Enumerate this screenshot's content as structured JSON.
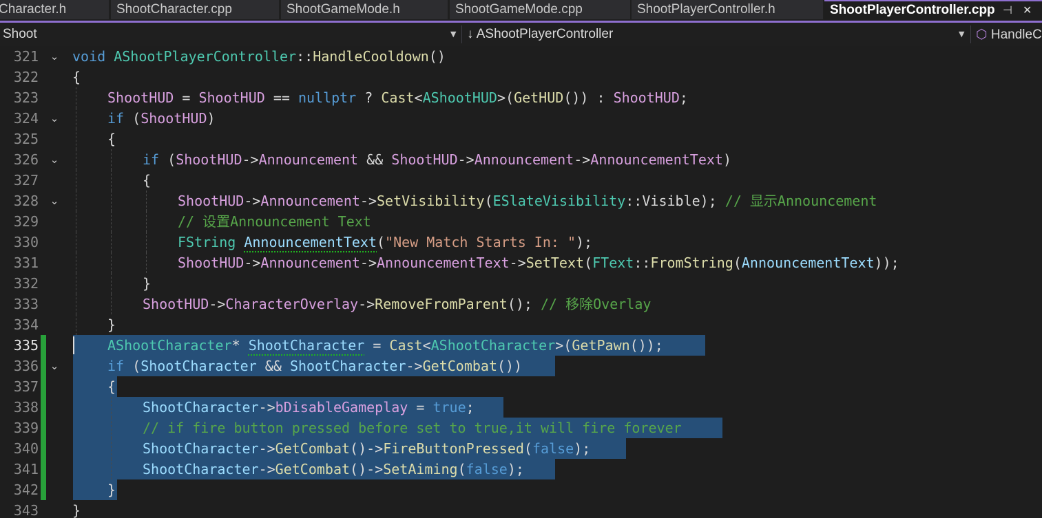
{
  "tabs": [
    {
      "label": "Character.h",
      "active": false
    },
    {
      "label": "ShootCharacter.cpp",
      "active": false
    },
    {
      "label": "ShootGameMode.h",
      "active": false
    },
    {
      "label": "ShootGameMode.cpp",
      "active": false
    },
    {
      "label": "ShootPlayerController.h",
      "active": false
    },
    {
      "label": "ShootPlayerController.cpp",
      "active": true
    }
  ],
  "tab_icons": {
    "pin": "⊣",
    "close": "✕"
  },
  "navbar": {
    "project": "Shoot",
    "scope_prefix": "↓",
    "scope": "AShootPlayerController",
    "member": "HandleC"
  },
  "editor": {
    "lines": [
      {
        "n": "321",
        "fold": true
      },
      {
        "n": "322",
        "fold": false
      },
      {
        "n": "323",
        "fold": false
      },
      {
        "n": "324",
        "fold": true
      },
      {
        "n": "325",
        "fold": false
      },
      {
        "n": "326",
        "fold": true
      },
      {
        "n": "327",
        "fold": false
      },
      {
        "n": "328",
        "fold": true
      },
      {
        "n": "329",
        "fold": false
      },
      {
        "n": "330",
        "fold": false
      },
      {
        "n": "331",
        "fold": false
      },
      {
        "n": "332",
        "fold": false
      },
      {
        "n": "333",
        "fold": false
      },
      {
        "n": "334",
        "fold": false
      },
      {
        "n": "335",
        "fold": false
      },
      {
        "n": "336",
        "fold": true
      },
      {
        "n": "337",
        "fold": false
      },
      {
        "n": "338",
        "fold": false
      },
      {
        "n": "339",
        "fold": false
      },
      {
        "n": "340",
        "fold": false
      },
      {
        "n": "341",
        "fold": false
      },
      {
        "n": "342",
        "fold": false
      },
      {
        "n": "343",
        "fold": false
      }
    ],
    "code": {
      "l321": [
        "void",
        "AShootPlayerController",
        "::",
        "HandleCooldown",
        "()"
      ],
      "l322": [
        "{"
      ],
      "l323": [
        "ShootHUD",
        " = ",
        "ShootHUD",
        " == ",
        "nullptr",
        " ? ",
        "Cast",
        "<",
        "AShootHUD",
        ">(",
        "GetHUD",
        "()) : ",
        "ShootHUD",
        ";"
      ],
      "l324": [
        "if",
        " (",
        "ShootHUD",
        ")"
      ],
      "l325": [
        "{"
      ],
      "l326": [
        "if",
        " (",
        "ShootHUD",
        "->",
        "Announcement",
        " && ",
        "ShootHUD",
        "->",
        "Announcement",
        "->",
        "AnnouncementText",
        ")"
      ],
      "l327": [
        "{"
      ],
      "l328": [
        "ShootHUD",
        "->",
        "Announcement",
        "->",
        "SetVisibility",
        "(",
        "ESlateVisibility",
        "::",
        "Visible",
        "); ",
        "// 显示Announcement"
      ],
      "l329": [
        "// 设置Announcement Text"
      ],
      "l330": [
        "FString",
        " ",
        "AnnouncementText",
        "(",
        "\"New Match Starts In: \"",
        ");"
      ],
      "l331": [
        "ShootHUD",
        "->",
        "Announcement",
        "->",
        "AnnouncementText",
        "->",
        "SetText",
        "(",
        "FText",
        "::",
        "FromString",
        "(",
        "AnnouncementText",
        "));"
      ],
      "l332": [
        "}"
      ],
      "l333": [
        "ShootHUD",
        "->",
        "CharacterOverlay",
        "->",
        "RemoveFromParent",
        "(); ",
        "// 移除Overlay"
      ],
      "l334": [
        "}"
      ],
      "l335": [
        "AShootCharacter",
        "* ",
        "ShootCharacter",
        " = ",
        "Cast",
        "<",
        "AShootCharacter",
        ">(",
        "GetPawn",
        "());"
      ],
      "l336": [
        "if",
        " (",
        "ShootCharacter",
        " && ",
        "ShootCharacter",
        "->",
        "GetCombat",
        "())"
      ],
      "l337": [
        "{"
      ],
      "l338": [
        "ShootCharacter",
        "->",
        "bDisableGameplay",
        " = ",
        "true",
        ";"
      ],
      "l339": [
        "// if fire button pressed before set to true,it will fire forever"
      ],
      "l340": [
        "ShootCharacter",
        "->",
        "GetCombat",
        "()->",
        "FireButtonPressed",
        "(",
        "false",
        ");"
      ],
      "l341": [
        "ShootCharacter",
        "->",
        "GetCombat",
        "()->",
        "SetAiming",
        "(",
        "false",
        ");"
      ],
      "l342": [
        "}"
      ],
      "l343": [
        "}"
      ]
    }
  },
  "colors": {
    "keyword": "#569cd6",
    "type": "#4ec9b0",
    "member": "#d8a0df",
    "function": "#dcdcaa",
    "parameter": "#9cdcfe",
    "comment": "#57a64a",
    "string": "#d69d85",
    "selection": "#264f78",
    "change_bar": "#28a13a",
    "accent": "#8e6fcf"
  }
}
